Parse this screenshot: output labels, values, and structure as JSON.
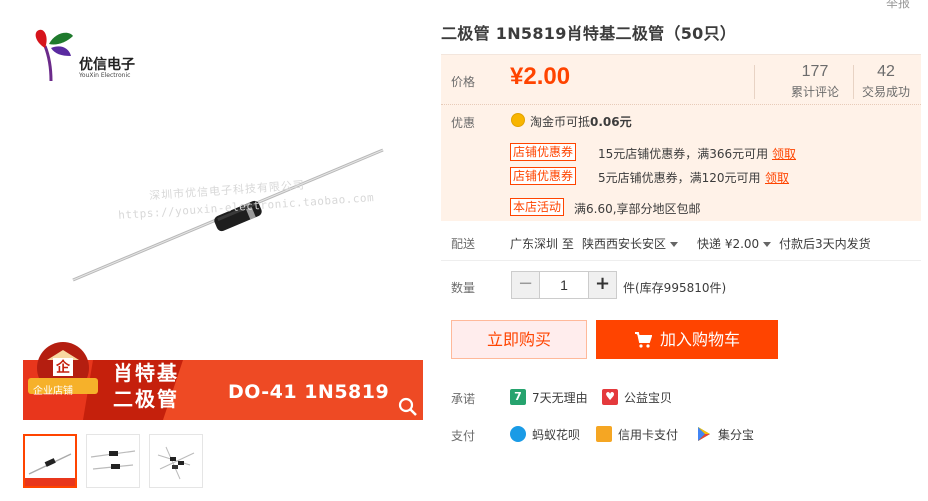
{
  "header": {
    "report_label": "举报"
  },
  "product": {
    "title": "二极管 1N5819肖特基二极管（50只）"
  },
  "gallery": {
    "logo_text": "优信电子",
    "logo_sub": "YouXin Electronic",
    "watermark_cn": "深圳市优信电子科技有限公司",
    "watermark_url": "https://youxin-electronic.taobao.com",
    "badge_text": "企业店铺",
    "banner_line1": "肖特基",
    "banner_line2": "二极管",
    "banner_model": "DO-41  1N5819",
    "thumbnails": [
      "thumb-1",
      "thumb-2",
      "thumb-3"
    ]
  },
  "price": {
    "label": "价格",
    "value": "¥2.00",
    "reviews_count": "177",
    "reviews_label": "累计评论",
    "sales_count": "42",
    "sales_label": "交易成功"
  },
  "promo": {
    "label": "优惠",
    "coin_text": "淘金币可抵",
    "coin_amount": "0.06元",
    "coupons": [
      {
        "tag": "店铺优惠券",
        "text": "15元店铺优惠券，满366元可用",
        "link": "领取"
      },
      {
        "tag": "店铺优惠券",
        "text": "5元店铺优惠券，满120元可用",
        "link": "领取"
      }
    ],
    "activity_tag": "本店活动",
    "activity_text": "满6.60,享部分地区包邮"
  },
  "shipping": {
    "label": "配送",
    "from": "广东深圳 至",
    "to": "陕西西安长安区",
    "method": "快递 ¥2.00",
    "dispatch": "付款后3天内发货"
  },
  "quantity": {
    "label": "数量",
    "value": "1",
    "minus": "−",
    "plus": "+",
    "stock": "件(库存995810件)"
  },
  "actions": {
    "buy_now": "立即购买",
    "add_cart": "加入购物车"
  },
  "promise": {
    "label": "承诺",
    "items": [
      "7天无理由",
      "公益宝贝"
    ]
  },
  "payment": {
    "label": "支付",
    "items": [
      "蚂蚁花呗",
      "信用卡支付",
      "集分宝"
    ]
  },
  "colors": {
    "accent": "#ff4400",
    "price_bg": "#fff2e8",
    "banner": "#e8361c"
  }
}
